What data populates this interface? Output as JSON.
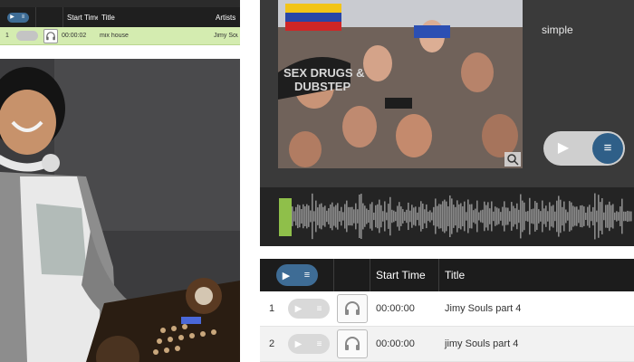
{
  "mini_table": {
    "headers": {
      "start_time": "Start Time",
      "title": "Title",
      "artists": "Artists"
    },
    "rows": [
      {
        "num": "1",
        "start_time": "00:00:02",
        "title": "mix house",
        "artist": "Jimy Souls"
      }
    ]
  },
  "player": {
    "track_title": "simple",
    "cover_text": {
      "line1": "SEX DRUGS &",
      "line2": "DUBSTEP"
    }
  },
  "playlist": {
    "headers": {
      "start_time": "Start Time",
      "title": "Title"
    },
    "rows": [
      {
        "num": "1",
        "start_time": "00:00:00",
        "title": "Jimy Souls part 4"
      },
      {
        "num": "2",
        "start_time": "00:00:00",
        "title": "jimy Souls part 4"
      }
    ]
  },
  "icons": {
    "play": "▶",
    "list": "≡"
  },
  "colors": {
    "accent_blue": "#3e6c95",
    "active_row_green": "#d4ecb0",
    "waveform_progress": "#8fbf4a",
    "header_dark": "#1f1f1f"
  }
}
